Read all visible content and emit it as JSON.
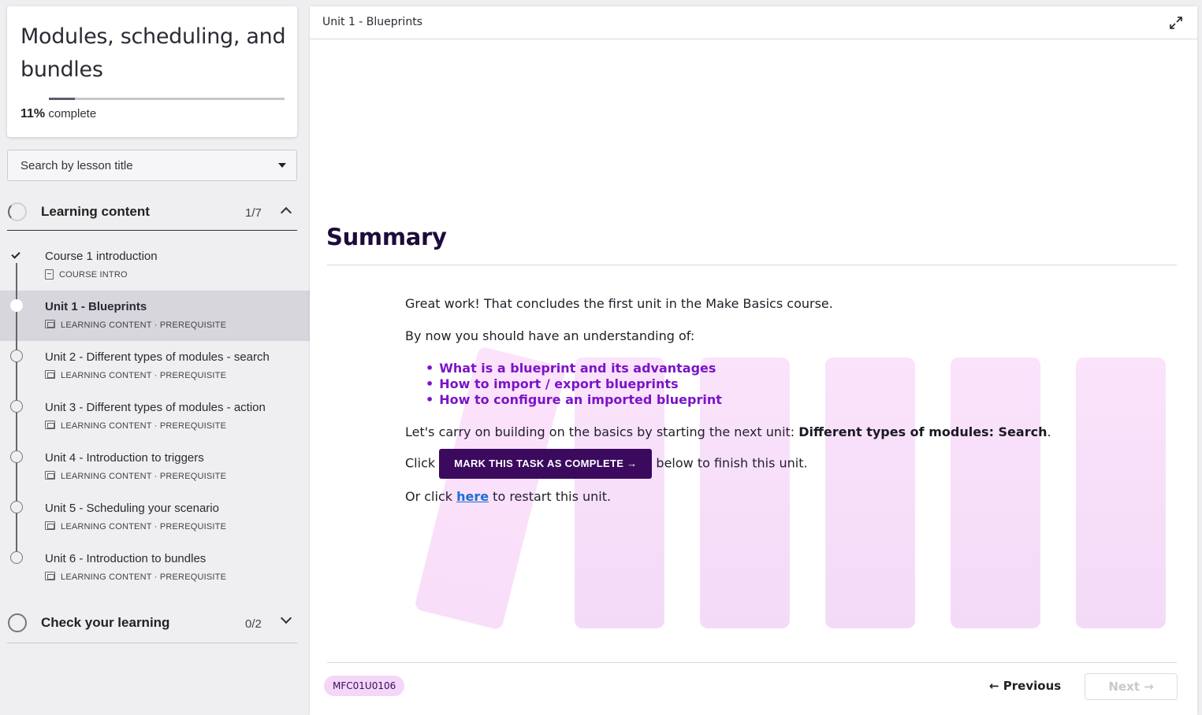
{
  "course": {
    "title": "Modules, scheduling, and bundles",
    "progress_percent": 11,
    "progress_value": "11%",
    "progress_suffix": "complete"
  },
  "search": {
    "placeholder": "Search by lesson title"
  },
  "sections": [
    {
      "label": "Learning content",
      "count": "1/7",
      "expanded": true,
      "lessons": [
        {
          "title": "Course 1 introduction",
          "meta": "COURSE INTRO",
          "status": "complete",
          "icon": "document-icon"
        },
        {
          "title": "Unit 1 - Blueprints",
          "meta": "LEARNING CONTENT · PREREQUISITE",
          "status": "active",
          "icon": "slides-icon"
        },
        {
          "title": "Unit 2 - Different types of modules - search",
          "meta": "LEARNING CONTENT · PREREQUISITE",
          "status": "not-started",
          "icon": "slides-icon"
        },
        {
          "title": "Unit 3 - Different types of modules - action",
          "meta": "LEARNING CONTENT · PREREQUISITE",
          "status": "not-started",
          "icon": "slides-icon"
        },
        {
          "title": "Unit 4 - Introduction to triggers",
          "meta": "LEARNING CONTENT · PREREQUISITE",
          "status": "not-started",
          "icon": "slides-icon"
        },
        {
          "title": "Unit 5 - Scheduling your scenario",
          "meta": "LEARNING CONTENT · PREREQUISITE",
          "status": "not-started",
          "icon": "slides-icon"
        },
        {
          "title": "Unit 6 - Introduction to bundles",
          "meta": "LEARNING CONTENT · PREREQUISITE",
          "status": "not-started",
          "icon": "slides-icon"
        }
      ]
    },
    {
      "label": "Check your learning",
      "count": "0/2",
      "expanded": false
    }
  ],
  "main": {
    "unit_title": "Unit 1 - Blueprints",
    "heading": "Summary",
    "intro": "Great work! That concludes the first unit in the Make Basics course.",
    "understanding_lead": "By now you should have an understanding of:",
    "bullets": [
      "What is a blueprint and its advantages",
      "How to import / export blueprints",
      "How to configure an imported blueprint"
    ],
    "carry_on_prefix": "Let's carry on building on the basics by starting the next unit: ",
    "carry_on_next": "Different types of modules: Search",
    "carry_on_suffix": ".",
    "click_prefix": "Click",
    "mark_button": "MARK THIS TASK AS COMPLETE →",
    "click_suffix": "below to finish this unit.",
    "restart_prefix": "Or click ",
    "restart_link": "here",
    "restart_suffix": " to restart this unit.",
    "lesson_code": "MFC01U0106",
    "previous_label": "← Previous",
    "next_label": "Next →"
  },
  "colors": {
    "accent_purple": "#3b0a5e",
    "bullet_purple": "#7b14c8",
    "link_blue": "#1b6fd6",
    "badge_pink": "#f3d6f8"
  }
}
